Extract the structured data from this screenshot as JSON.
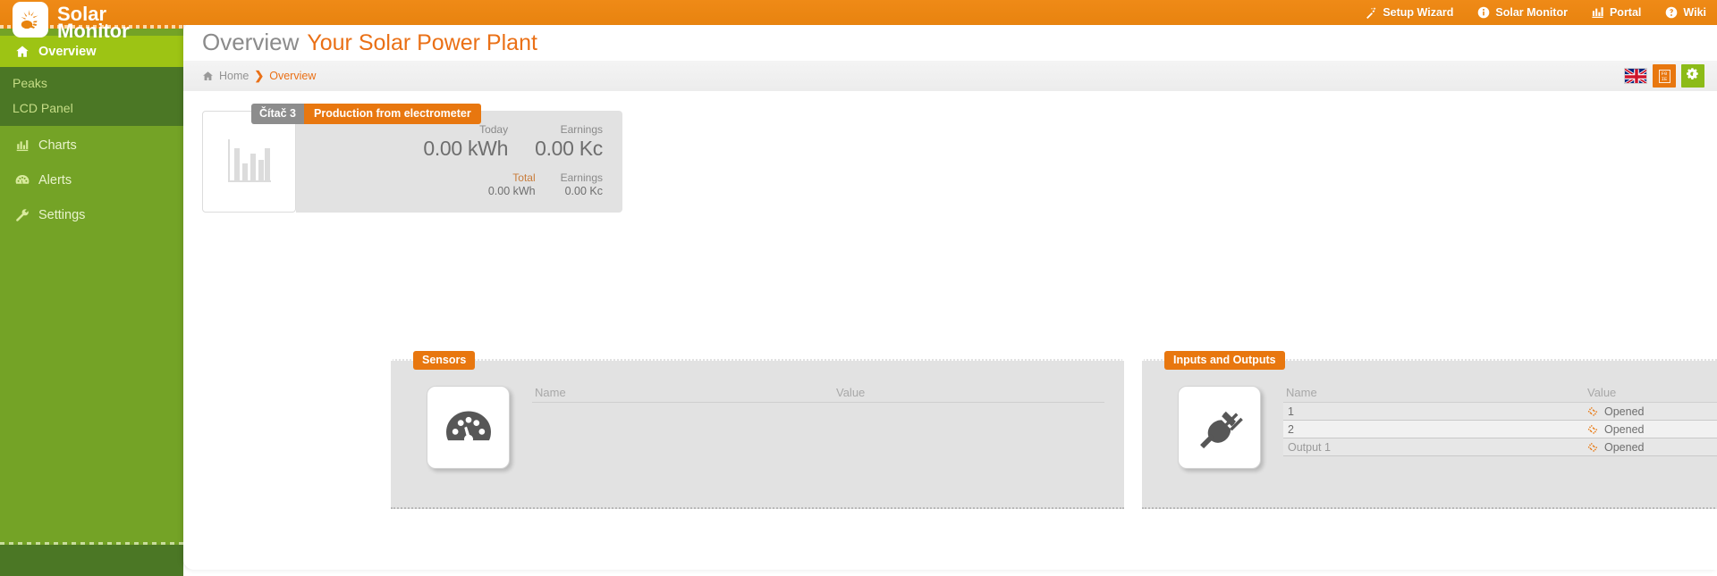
{
  "topbar": {
    "items": [
      {
        "label": "Setup Wizard",
        "icon": "magic-wand-icon"
      },
      {
        "label": "Solar Monitor",
        "icon": "info-circle-icon"
      },
      {
        "label": "Portal",
        "icon": "bar-chart-icon"
      },
      {
        "label": "Wiki",
        "icon": "question-circle-icon"
      }
    ]
  },
  "brand": {
    "line1": "Solar",
    "line2": "Monitor",
    "logo_icon": "solar-panel-hand-logo"
  },
  "sidebar": {
    "items": [
      {
        "label": "Overview",
        "icon": "home-icon",
        "active": true
      },
      {
        "label": "Charts",
        "icon": "bar-chart-icon",
        "active": false
      },
      {
        "label": "Alerts",
        "icon": "gauge-icon",
        "active": false
      },
      {
        "label": "Settings",
        "icon": "wrench-icon",
        "active": false
      }
    ],
    "subitems": [
      {
        "label": "Peaks"
      },
      {
        "label": "LCD Panel"
      }
    ]
  },
  "header": {
    "title": "Overview",
    "subtitle": "Your Solar Power Plant"
  },
  "breadcrumb": {
    "home": "Home",
    "separator": "❯",
    "current": "Overview",
    "home_icon": "home-icon"
  },
  "toolbar": {
    "flag": "uk-flag-icon",
    "doc_button_glyph": "F0\nIE",
    "settings_icon": "gears-icon"
  },
  "production_card": {
    "tab_counter": "Čítač 3",
    "tab_title": "Production from electrometer",
    "thumb_icon": "bar-chart-thumbnail",
    "today_label": "Today",
    "today_value": "0.00 kWh",
    "today_earnings_label": "Earnings",
    "today_earnings_value": "0.00 Kc",
    "total_label": "Total",
    "total_value": "0.00 kWh",
    "total_earnings_label": "Earnings",
    "total_earnings_value": "0.00 Kc"
  },
  "sensors_panel": {
    "tab": "Sensors",
    "icon": "gauge-icon",
    "col_name": "Name",
    "col_value": "Value",
    "rows": []
  },
  "io_panel": {
    "tab": "Inputs and Outputs",
    "icon": "power-plug-icon",
    "col_name": "Name",
    "col_value": "Value",
    "rows": [
      {
        "name": "1",
        "status": "Opened",
        "status_icon": "chain-broken-icon",
        "dim": false
      },
      {
        "name": "2",
        "status": "Opened",
        "status_icon": "chain-broken-icon",
        "dim": false
      },
      {
        "name": "Output 1",
        "status": "Opened",
        "status_icon": "chain-broken-icon",
        "dim": true
      }
    ]
  },
  "colors": {
    "brand_orange": "#e8830f",
    "accent_orange": "#e8770f",
    "sidebar_green": "#74a326",
    "sidebar_active_green": "#9dc414",
    "sidebar_sub_green": "#4b7725",
    "title_grey": "#8b8b8b"
  }
}
